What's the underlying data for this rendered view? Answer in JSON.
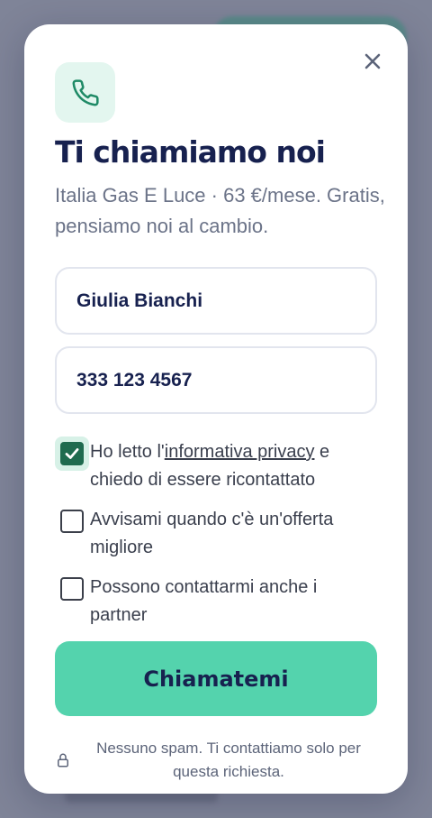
{
  "modal": {
    "title": "Ti chiamiamo noi",
    "subtitle": "Italia Gas E Luce · 63 €/mese. Gratis, pensiamo noi al cambio.",
    "icon": "phone-icon",
    "close_icon": "close-icon"
  },
  "form": {
    "name_value": "Giulia Bianchi",
    "phone_value": "333 123 4567"
  },
  "consents": [
    {
      "checked": true,
      "text_before": "Ho letto l'",
      "link": "informativa privacy",
      "text_after": " e chiedo di essere ricontattato"
    },
    {
      "checked": false,
      "text": "Avvisami quando c'è un'offerta migliore"
    },
    {
      "checked": false,
      "text": "Possono contattarmi anche i partner"
    }
  ],
  "cta": {
    "label": "Chiamatemi"
  },
  "footer": {
    "icon": "lock-icon",
    "text": "Nessuno spam. Ti contattiamo solo per questa richiesta."
  },
  "colors": {
    "accent": "#54d3ad",
    "title": "#17214f",
    "check": "#1f6b4f",
    "overlay": "#7f8498"
  }
}
